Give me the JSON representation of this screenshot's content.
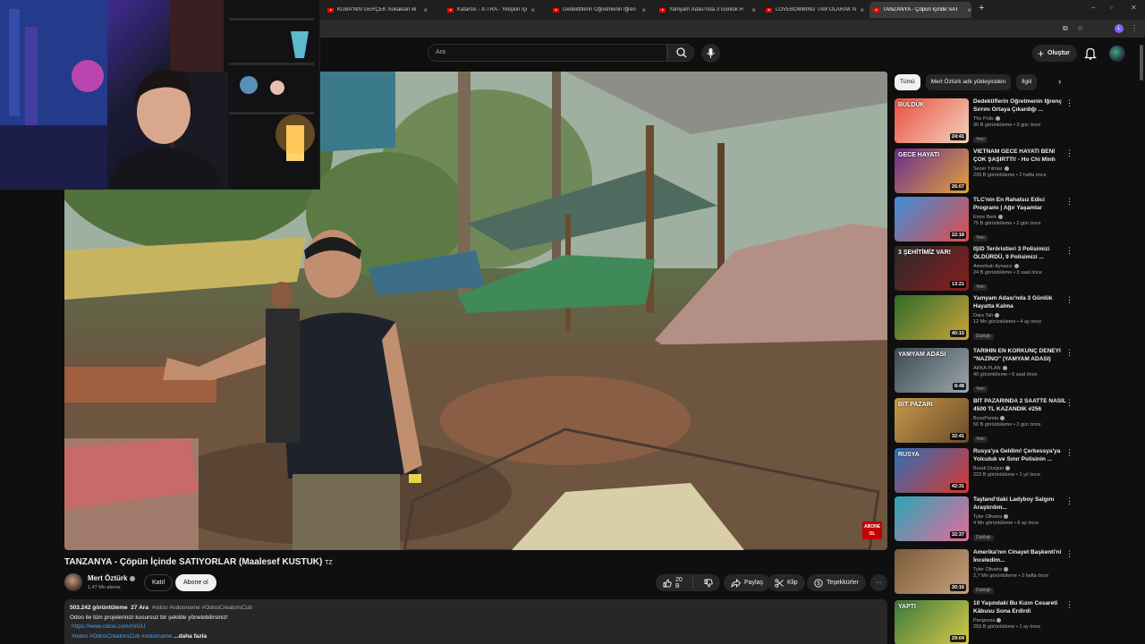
{
  "browser": {
    "tabs": [
      {
        "title": "KÜBA'NIN GERÇEK Sokakları Bi"
      },
      {
        "title": "Katarsis - X-TRA - Yetişkin İçerikl"
      },
      {
        "title": "Dedektiflerin Öğretmenin İğren"
      },
      {
        "title": "Yamyam Adası'nda 3 Günlük H"
      },
      {
        "title": "LOVEBOMBING TAM OLARAK N"
      },
      {
        "title": "TANZANYA - Çöpün İçinde SAT"
      }
    ],
    "new_tab": "+",
    "profile_letter": "L"
  },
  "header": {
    "search_placeholder": "Ara",
    "create_label": "Oluştur"
  },
  "video": {
    "title": "TANZANYA - Çöpün İçinde SATIYORLAR (Maalesef KUSTUK)",
    "title_suffix": "TZ",
    "logo_text": "ABONE OL"
  },
  "channel": {
    "name": "Mert Öztürk",
    "subscribers": "1,47 Mn abone",
    "join_label": "Katıl",
    "subscribe_label": "Abone ol"
  },
  "actions": {
    "likes": "20 B",
    "share": "Paylaş",
    "clip": "Klip",
    "thanks": "Teşekkürler",
    "more": "···"
  },
  "description": {
    "views": "503.242 görüntüleme",
    "date": "27 Ara",
    "hashtags": "#odoo #odooname #OdooCreatorsCub",
    "line1": "Odoo ile tüm projelerinizi kusursuz bir şekilde yönetebilirsiniz!",
    "link": "https://www.odoo.com/r/xGU",
    "tags2": "#odoo #OdooCreatorsCub #odooname",
    "more_label": "...daha fazla"
  },
  "sidebar": {
    "chips": [
      {
        "label": "Tümü"
      },
      {
        "label": "Mert Öztürk adlı yükleyiciden"
      },
      {
        "label": "İlgili"
      }
    ],
    "videos": [
      {
        "title": "Dedektiflerin Öğretmenin İğrenç Sırrını Ortaya Çıkardığı ...",
        "channel": "The Polis",
        "meta": "36 B görüntüleme • 3 gün önce",
        "badge": "Yeni",
        "duration": "24:41",
        "thumb_text": "BULDUK",
        "c1": "#e84f3d",
        "c2": "#f3d3c0"
      },
      {
        "title": "VİETNAM GECE HAYATI BENİ ÇOK ŞAŞIRTTI! - Ho Chi Minh",
        "channel": "Sezer Yılmaz",
        "meta": "239 B görüntüleme • 2 hafta önce",
        "badge": "",
        "duration": "26:07",
        "thumb_text": "GECE HAYATI",
        "c1": "#6a2c91",
        "c2": "#e2a23b"
      },
      {
        "title": "TLC'nin En Rahatsız Edici Programı | Ağır Yaşamlar",
        "channel": "Emre Berk",
        "meta": "75 B görüntüleme • 2 gün önce",
        "badge": "Yeni",
        "duration": "22:18",
        "thumb_text": "",
        "c1": "#3b8fd8",
        "c2": "#e14c4c"
      },
      {
        "title": "İŞİD Teröristleri 3 Polisimizi ÖLDÜRDÜ, 9 Polisimizi ...",
        "channel": "Amerikalı Aynasız",
        "meta": "24 B görüntüleme • 3 saat önce",
        "badge": "Yeni",
        "duration": "13:21",
        "thumb_text": "3 ŞEHİTİMİZ VAR!",
        "c1": "#2a2a2a",
        "c2": "#8a1e1e"
      },
      {
        "title": "Yamyam Adası'nda 3 Günlük Hayatta Kalma",
        "channel": "Dara Tah",
        "meta": "12 Mn görüntüleme • 4 ay önce",
        "badge": "Dublajlı",
        "duration": "40:15",
        "thumb_text": "",
        "c1": "#2f6b2a",
        "c2": "#caa43a"
      },
      {
        "title": "TARİHİN EN KORKUNÇ DENEYİ \"NAZİNO\" (YAMYAM ADASI)",
        "channel": "ARKA PLAN",
        "meta": "40 görüntüleme • 5 saat önce",
        "badge": "Yeni",
        "duration": "8:48",
        "thumb_text": "YAMYAM ADASI",
        "c1": "#3e4a52",
        "c2": "#9aa6ac"
      },
      {
        "title": "BİT PAZARINDA 2 SAATTE NASIL 4500 TL KAZANDIK #256",
        "channel": "BossPanda",
        "meta": "56 B görüntüleme • 2 gün önce",
        "badge": "Yeni",
        "duration": "32:41",
        "thumb_text": "BİT PAZARI",
        "c1": "#c79a4a",
        "c2": "#6b4a2a"
      },
      {
        "title": "Rusya'ya Geldim! Çerkessya'ya Yolculuk ve Sınır Polisinin ...",
        "channel": "Burak Durgun",
        "meta": "223 B görüntüleme • 1 yıl önce",
        "badge": "",
        "duration": "42:31",
        "thumb_text": "RUSYA",
        "c1": "#2e6fb8",
        "c2": "#d8382f"
      },
      {
        "title": "Tayland'daki Ladyboy Salgını Araştırdım...",
        "channel": "Tyler Oliveira",
        "meta": "4 Mn görüntüleme • 8 ay önce",
        "badge": "Dublajlı",
        "duration": "32:37",
        "thumb_text": "",
        "c1": "#2aa6b8",
        "c2": "#e56a9a"
      },
      {
        "title": "Amerika'nın Cinayet Başkenti'ni İnceledim...",
        "channel": "Tyler Oliveira",
        "meta": "2,7 Mn görüntüleme • 3 hafta önce",
        "badge": "Dublajlı",
        "duration": "30:16",
        "thumb_text": "",
        "c1": "#7a5a3a",
        "c2": "#c7a07a"
      },
      {
        "title": "10 Yaşındaki Bu Kızın Cesareti Kâbusu Sona Erdirdi",
        "channel": "Pangovsa",
        "meta": "259 B görüntüleme • 1 ay önce",
        "badge": "",
        "duration": "29:04",
        "thumb_text": "YAPTI",
        "c1": "#3a7a3a",
        "c2": "#d8c84a"
      }
    ]
  },
  "colors": {
    "background": "#0f0f0f",
    "pill": "#272727",
    "link": "#3ea6ff",
    "brand_red": "#ff0000"
  }
}
